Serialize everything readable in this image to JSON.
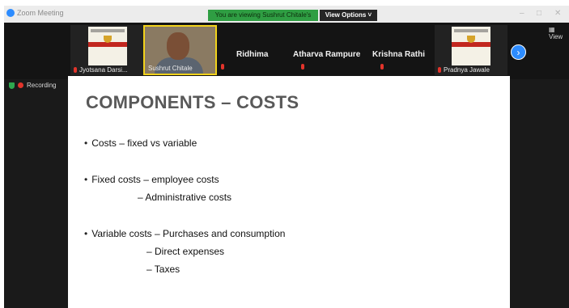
{
  "titlebar": {
    "app_title": "Zoom Meeting",
    "viewing_banner": "You are viewing Sushrut Chitale's screen",
    "view_options": "View Options ˅",
    "controls": [
      "–",
      "□",
      "✕"
    ]
  },
  "participants": [
    {
      "name": "Jyotsana Darsi...",
      "kind": "certificate"
    },
    {
      "name": "Sushrut Chitale",
      "kind": "video"
    },
    {
      "name": "Ridhima",
      "kind": "name"
    },
    {
      "name": "Atharva Rampure",
      "kind": "name"
    },
    {
      "name": "Krishna Rathi",
      "kind": "name"
    },
    {
      "name": "Pradnya Jawale",
      "kind": "certificate"
    }
  ],
  "view_button": "▦ View",
  "recording_label": "Recording",
  "slide": {
    "title": "COMPONENTS – COSTS",
    "lines": [
      "Costs – fixed vs variable",
      "Fixed costs – employee costs",
      "–  Administrative costs",
      "Variable costs – Purchases and consumption",
      "–  Direct expenses",
      "–  Taxes"
    ]
  },
  "colors": {
    "banner_green": "#2f9e43",
    "active_speaker": "#f2d21b",
    "zoom_blue": "#2d8cff",
    "recording_red": "#e2342b"
  }
}
